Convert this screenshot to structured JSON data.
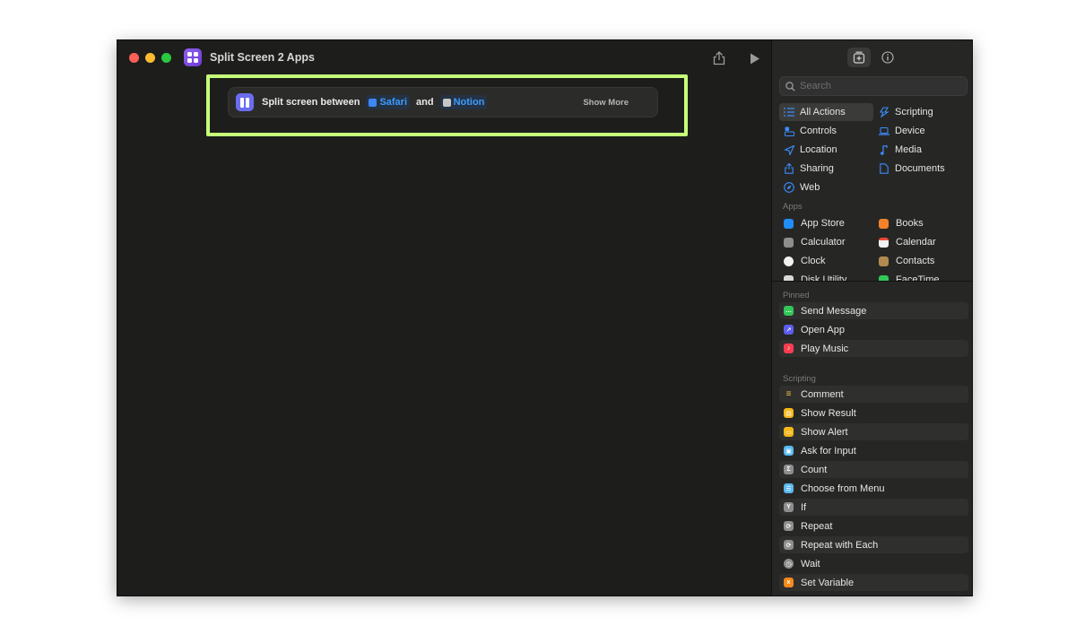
{
  "window": {
    "title": "Split Screen 2 Apps"
  },
  "editor": {
    "action": {
      "prefix": "Split screen between",
      "app1": "Safari",
      "connector": "and",
      "app2": "Notion",
      "show_more": "Show More"
    }
  },
  "sidebar": {
    "search_placeholder": "Search",
    "categories": [
      {
        "label": "All Actions",
        "icon": "list-icon",
        "selected": true
      },
      {
        "label": "Scripting",
        "icon": "scripting-icon"
      },
      {
        "label": "Controls",
        "icon": "controls-icon"
      },
      {
        "label": "Device",
        "icon": "device-icon"
      },
      {
        "label": "Location",
        "icon": "location-icon"
      },
      {
        "label": "Media",
        "icon": "music-note-icon"
      },
      {
        "label": "Sharing",
        "icon": "share-icon"
      },
      {
        "label": "Documents",
        "icon": "document-icon"
      },
      {
        "label": "Web",
        "icon": "compass-icon"
      }
    ],
    "apps_label": "Apps",
    "apps": [
      {
        "label": "App Store",
        "color": "#1f8efa"
      },
      {
        "label": "Books",
        "color": "#f5822a"
      },
      {
        "label": "Calculator",
        "color": "#8e8e8e"
      },
      {
        "label": "Calendar",
        "color": "#f2f2f2"
      },
      {
        "label": "Clock",
        "color": "#f2f2f2"
      },
      {
        "label": "Contacts",
        "color": "#b08a4f"
      },
      {
        "label": "Disk Utility",
        "color": "#d9d9d9"
      },
      {
        "label": "FaceTime",
        "color": "#33c759"
      }
    ],
    "pinned_label": "Pinned",
    "pinned": [
      {
        "label": "Send Message",
        "color": "#33c759",
        "glyph": "…"
      },
      {
        "label": "Open App",
        "color": "#5d5df0",
        "glyph": "↗"
      },
      {
        "label": "Play Music",
        "color": "#fa3d52",
        "glyph": "♪"
      }
    ],
    "scripting_label": "Scripting",
    "scripting": [
      {
        "label": "Comment",
        "color": "#f3c43a",
        "glyph": "≡"
      },
      {
        "label": "Show Result",
        "color": "#f5b81a",
        "glyph": "▤"
      },
      {
        "label": "Show Alert",
        "color": "#f5b81a",
        "glyph": "▭"
      },
      {
        "label": "Ask for Input",
        "color": "#5ab8f0",
        "glyph": "▣"
      },
      {
        "label": "Count",
        "color": "#8e8e8e",
        "glyph": "Σ"
      },
      {
        "label": "Choose from Menu",
        "color": "#5ab8f0",
        "glyph": "☰"
      },
      {
        "label": "If",
        "color": "#8e8e8e",
        "glyph": "Y"
      },
      {
        "label": "Repeat",
        "color": "#8e8e8e",
        "glyph": "⟳"
      },
      {
        "label": "Repeat with Each",
        "color": "#8e8e8e",
        "glyph": "⟳"
      },
      {
        "label": "Wait",
        "color": "#8e8e8e",
        "glyph": "◷"
      },
      {
        "label": "Set Variable",
        "color": "#f58a1a",
        "glyph": "x"
      }
    ]
  }
}
